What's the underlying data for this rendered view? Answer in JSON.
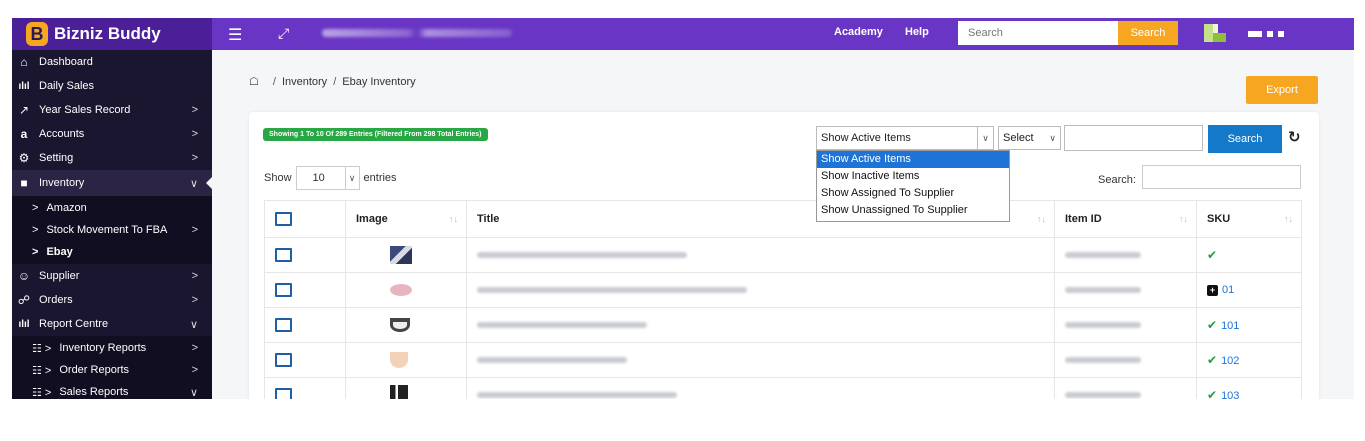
{
  "brand": {
    "logo_letter": "B",
    "name": "Bizniz Buddy"
  },
  "topbar": {
    "menu_icon": "hamburger-icon",
    "expand_icon": "expand-icon",
    "nav": [
      "Academy",
      "Help"
    ],
    "search_placeholder": "Search",
    "search_button": "Search"
  },
  "sidebar": {
    "items": [
      {
        "label": "Dashboard",
        "icon": "home-icon",
        "chevron": ""
      },
      {
        "label": "Daily Sales",
        "icon": "bar-chart-icon",
        "chevron": ""
      },
      {
        "label": "Year Sales Record",
        "icon": "line-chart-icon",
        "chevron": ">"
      },
      {
        "label": "Accounts",
        "icon": "amazon-icon",
        "chevron": ">"
      },
      {
        "label": "Setting",
        "icon": "gear-icon",
        "chevron": ">"
      },
      {
        "label": "Inventory",
        "icon": "factory-icon",
        "chevron": "v"
      }
    ],
    "inventory_sub": [
      {
        "label": "Amazon",
        "chevron": ""
      },
      {
        "label": "Stock Movement To FBA",
        "chevron": ">"
      },
      {
        "label": "Ebay",
        "chevron": ""
      }
    ],
    "items2": [
      {
        "label": "Supplier",
        "icon": "user-icon",
        "chevron": ">"
      },
      {
        "label": "Orders",
        "icon": "cart-icon",
        "chevron": ">"
      },
      {
        "label": "Report Centre",
        "icon": "bar-chart-icon",
        "chevron": "v"
      }
    ],
    "report_sub": [
      {
        "label": "Inventory Reports",
        "chevron": ">"
      },
      {
        "label": "Order Reports",
        "chevron": ">"
      },
      {
        "label": "Sales Reports",
        "chevron": "v"
      }
    ]
  },
  "breadcrumb": {
    "items": [
      "Inventory",
      "Ebay Inventory"
    ],
    "separator": "/"
  },
  "export_button": "Export",
  "filter": {
    "badge": "Showing 1 To 10 Of 289 Entries (Filtered From 298 Total Entries)",
    "status_selected": "Show Active Items",
    "status_options": [
      "Show Active Items",
      "Show Inactive Items",
      "Show Assigned To Supplier",
      "Show Unassigned To Supplier"
    ],
    "select2": "Select",
    "search_button": "Search"
  },
  "table_controls": {
    "show": "Show",
    "entries_value": "10",
    "entries": "entries",
    "search_label": "Search:"
  },
  "table": {
    "headers": [
      "Image",
      "Title",
      "Item ID",
      "SKU"
    ],
    "rows": [
      {
        "sku_type": "check",
        "sku": ""
      },
      {
        "sku_type": "plus",
        "sku": "01"
      },
      {
        "sku_type": "check",
        "sku": "101"
      },
      {
        "sku_type": "check",
        "sku": "102"
      },
      {
        "sku_type": "check",
        "sku": "103"
      }
    ]
  },
  "colors": {
    "topbar": "#6935c4",
    "brand_bg": "#4a1f97",
    "sidebar": "#1b1630",
    "accent_orange": "#f7a622",
    "primary_blue": "#1479c8",
    "success_green": "#28a745"
  }
}
